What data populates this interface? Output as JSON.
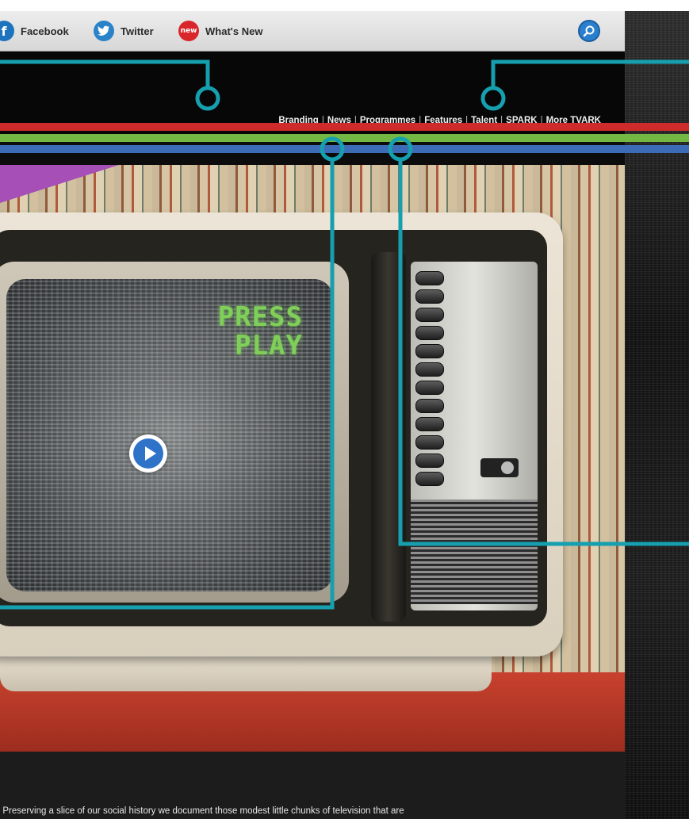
{
  "social_bar": {
    "facebook_label": "Facebook",
    "twitter_label": "Twitter",
    "whats_new_label": "What's New",
    "whats_new_badge": "new"
  },
  "nav": {
    "items": [
      "Branding",
      "News",
      "Programmes",
      "Features",
      "Talent",
      "SPARK",
      "More TVARK"
    ]
  },
  "hero": {
    "screen_text_line1": "PRESS",
    "screen_text_line2": "PLAY"
  },
  "footer": {
    "text": ". Preserving a slice of our social history we document those modest little chunks of television that are"
  },
  "colors": {
    "stripe_red": "#cf2b2a",
    "stripe_green": "#72b843",
    "stripe_blue": "#3c6cb6",
    "callout": "#169fae",
    "accent_purple": "#a54fb7"
  },
  "icons": [
    "facebook-icon",
    "twitter-icon",
    "whats-new-icon",
    "search-icon",
    "play-icon"
  ]
}
